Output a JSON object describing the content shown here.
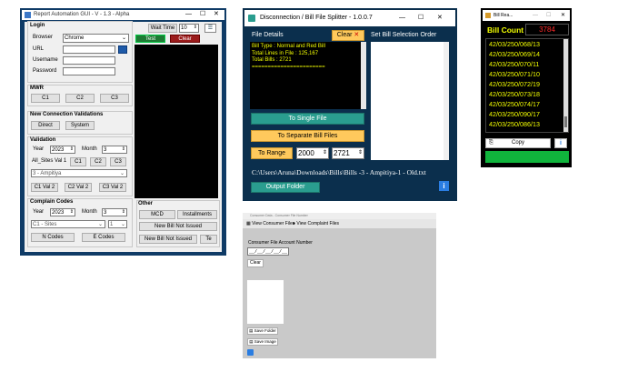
{
  "w1": {
    "title": "Report Automation GUI - V - 1.3 - Alpha",
    "min": "—",
    "max": "☐",
    "close": "✕",
    "login": {
      "heading": "Login",
      "browser_label": "Browser",
      "browser_value": "Chrome",
      "url_label": "URL",
      "username_label": "Username",
      "password_label": "Password",
      "url_value": "",
      "username_value": "",
      "password_value": ""
    },
    "wait": {
      "label": "Wait Time",
      "value": "10",
      "test": "Test",
      "clear": "Clear"
    },
    "mwr": {
      "heading": "MWR",
      "b1": "C1",
      "b2": "C2",
      "b3": "C3"
    },
    "newconn": {
      "heading": "New Connection Validations",
      "direct": "Direct",
      "system": "System"
    },
    "validation": {
      "heading": "Validation",
      "year_label": "Year",
      "year": "2023",
      "month_label": "Month",
      "month": "3",
      "all_sites": "All_Sites Val 1",
      "c1": "C1",
      "c2": "C2",
      "c3": "C3",
      "site": "3 - Ampitiya",
      "c1v2": "C1 Val 2",
      "c2v2": "C2 Val 2",
      "c3v2": "C3 Val 2"
    },
    "complain": {
      "heading": "Complain Codes",
      "year_label": "Year",
      "year": "2023",
      "month_label": "Month",
      "month": "3",
      "site": "C1 - Sites",
      "num": "1",
      "ncodes": "N Codes",
      "ecodes": "E Codes"
    },
    "other": {
      "heading": "Other",
      "mcd": "MCD",
      "installments": "Installments",
      "new_bill1": "New Bill Not Issued",
      "new_bill2": "New Bill Not Issued",
      "te": "Te"
    }
  },
  "w2": {
    "title": "Disconnection / Bill File Splitter - 1.0.0.7",
    "min": "—",
    "max": "☐",
    "close": "✕",
    "file_details": "File Details",
    "clear": "Clear",
    "clear_x": "✕",
    "selection": "Set Bill Selection Order",
    "details": [
      "Bill Type : Normal and Red Bill",
      "Total Lines in File : 125,167",
      "Total Bills : 2721",
      "======================="
    ],
    "to_single": "To Single File",
    "to_separate": "To Separate Bill Files",
    "to_range": "To Range",
    "range_from": "2000",
    "range_to": "2721",
    "path": "C:\\Users\\Aruna\\Downloads\\Bills\\Bills -3 - Ampitiya-1 - Old.txt",
    "output": "Output Folder",
    "info": "i"
  },
  "w3": {
    "title": "Bill Rea...",
    "min": "—",
    "max": "☐",
    "close": "✕",
    "count_label": "Bill Count",
    "count": "3784",
    "items": [
      "42/03/250/068/13",
      "42/03/250/069/14",
      "42/03/250/070/11",
      "42/03/250/071/10",
      "42/03/250/072/19",
      "42/03/250/073/18",
      "42/03/250/074/17",
      "42/03/250/090/17",
      "42/03/250/086/13"
    ],
    "copy": "Copy",
    "info": "i"
  },
  "w4": {
    "title": "Consumer Data - Consumer File Number",
    "tab1": "View Consumer Files",
    "tab2": "View Complaint Files",
    "acct_label": "Consumer File Account Number",
    "acct_value": "__/__/__/__/__",
    "clear": "Clear",
    "save_folder": "Save Folder",
    "save_image": "Save Image"
  },
  "colors": {
    "w1_frame": "#0f3b66",
    "w2_frame": "#0b2f4d",
    "teal": "#2a9d8f",
    "yellow": "#f3ff00",
    "gold": "#ffc95c",
    "green": "#10b43c",
    "red_text": "#ff2a2a",
    "test_green": "#1e7b34",
    "clear_red": "#9b1b1b"
  }
}
